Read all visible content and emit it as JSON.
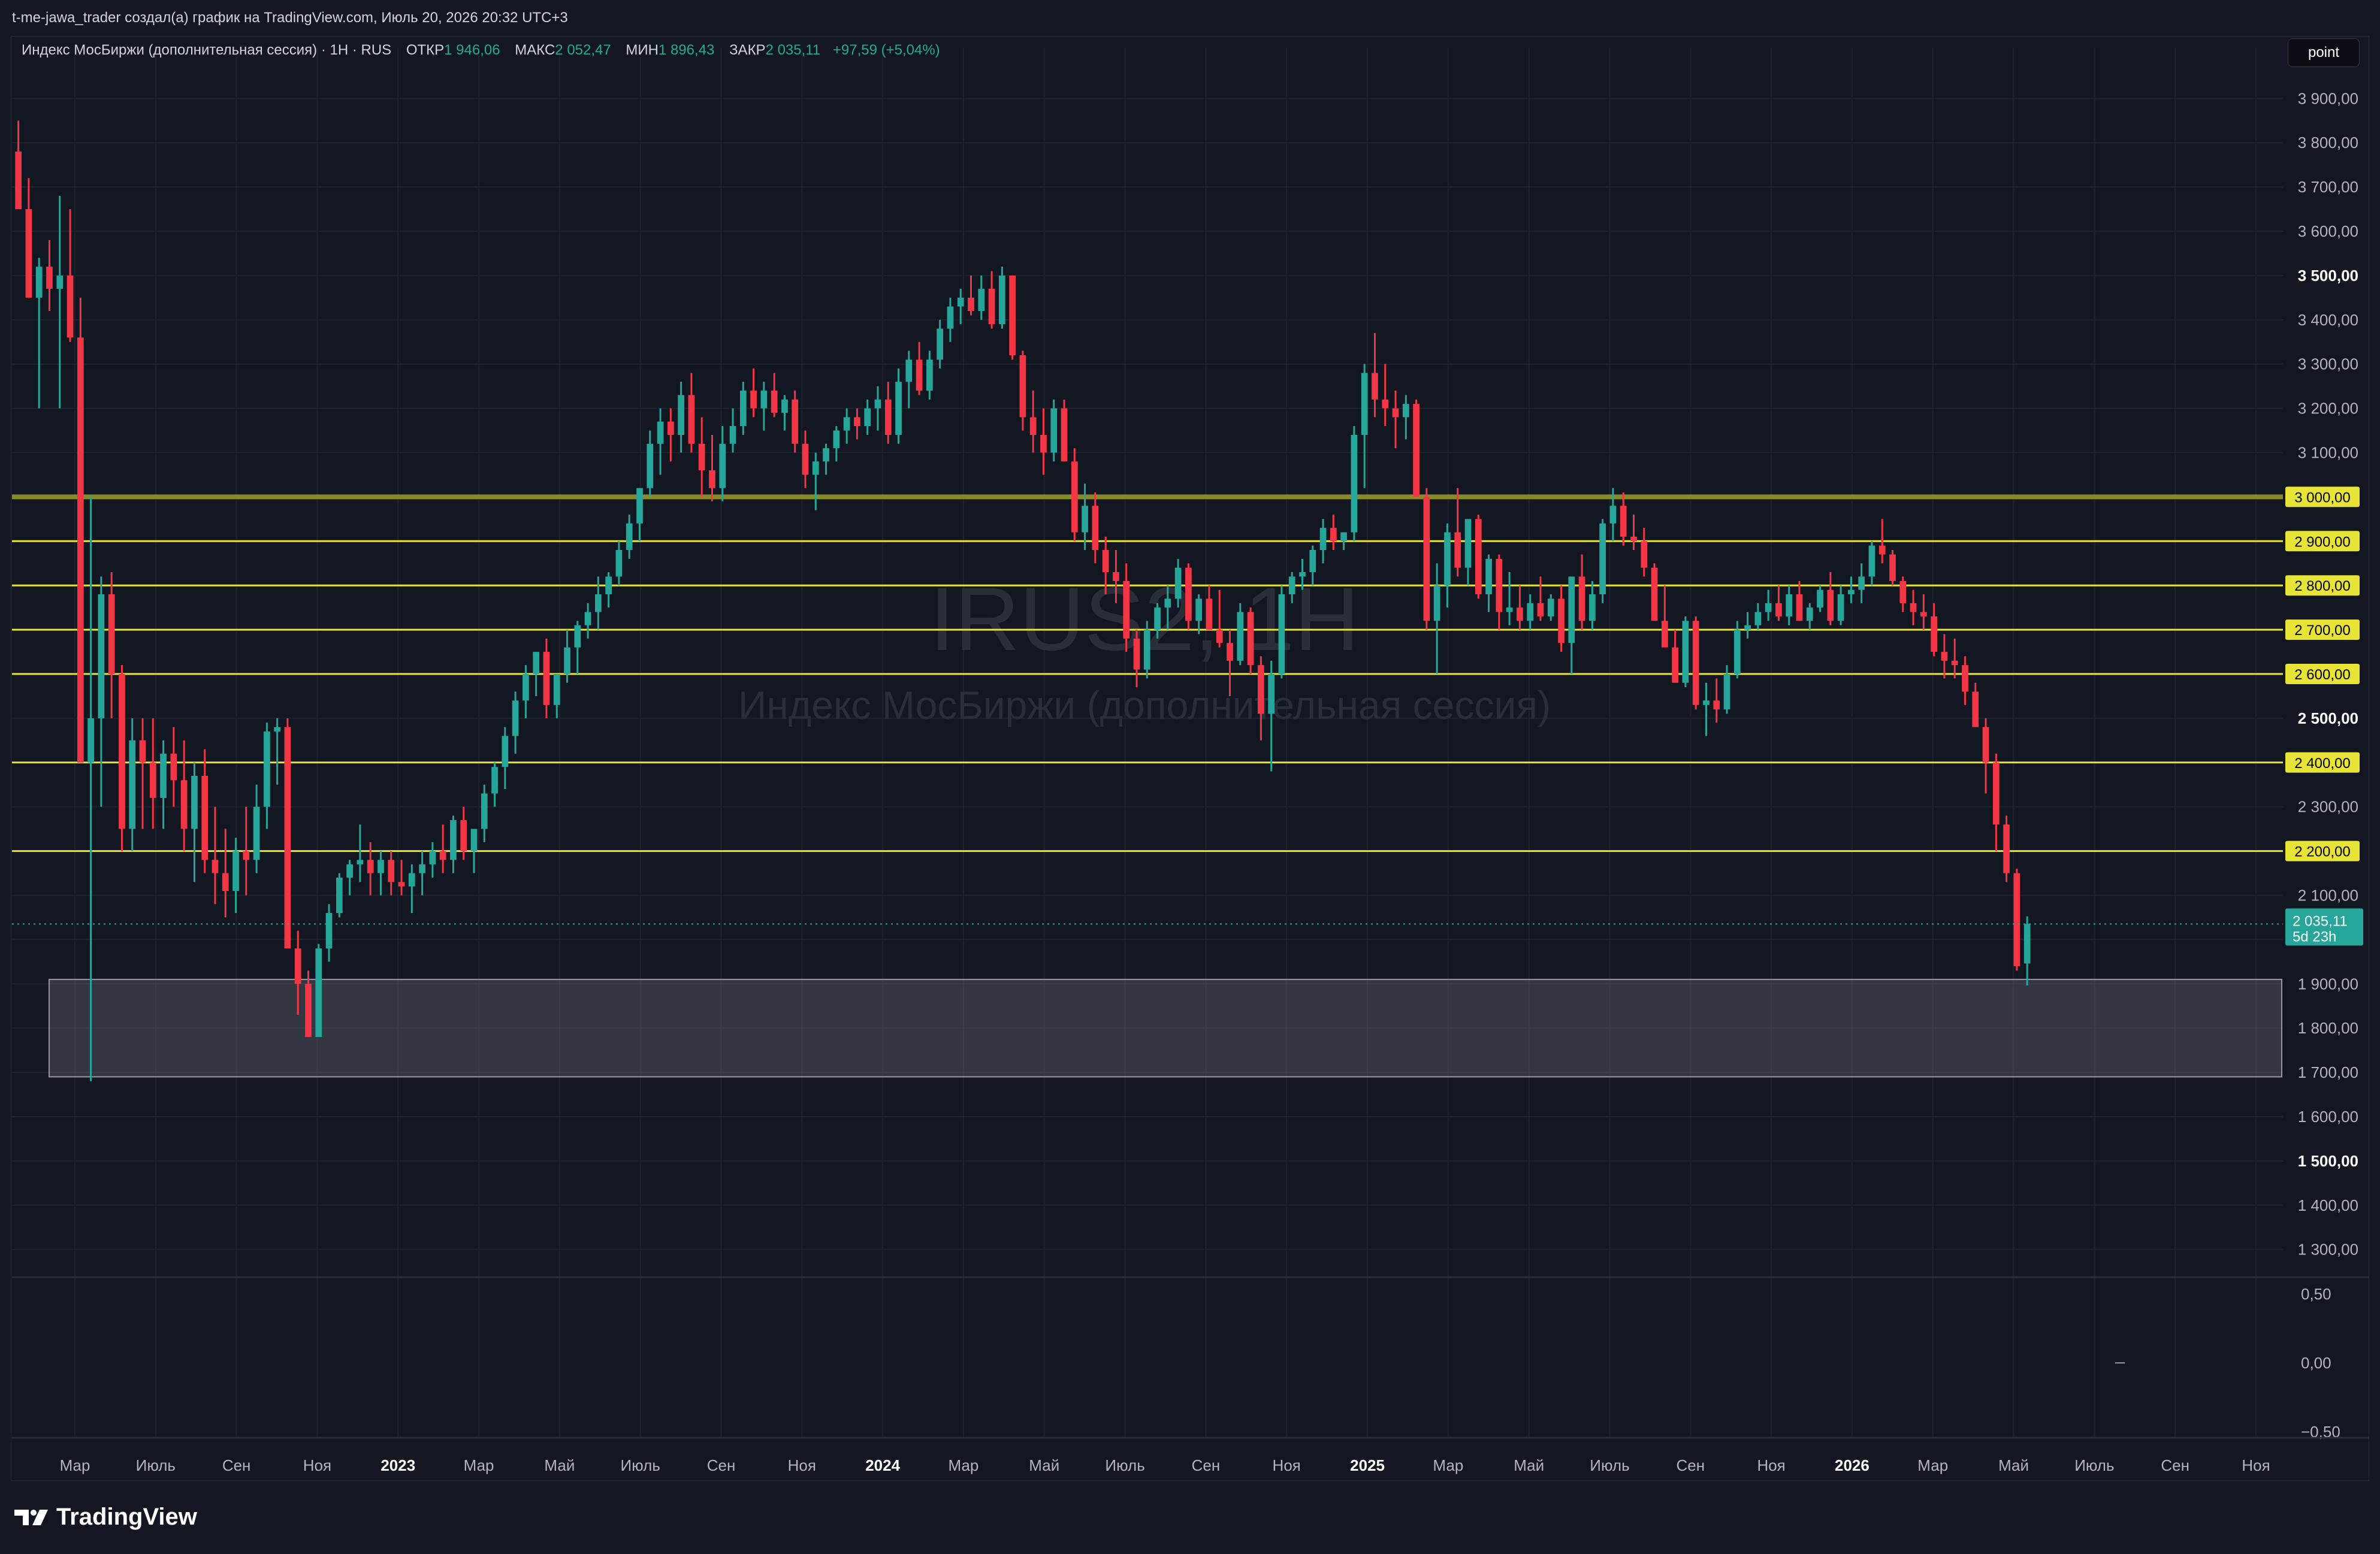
{
  "header": {
    "attribution": "t-me-jawa_trader создал(а) график на TradingView.com, Июль 20, 2026 20:32 UTC+3"
  },
  "legend": {
    "symbol": "Индекс МосБиржи (дополнительная сессия) · 1H · RUS",
    "open_label": "ОТКР",
    "open_value": "1 946,06",
    "high_label": "МАКС",
    "high_value": "2 052,47",
    "low_label": "МИН",
    "low_value": "1 896,43",
    "close_label": "ЗАКР",
    "close_value": "2 035,11",
    "change": "+97,59 (+5,04%)"
  },
  "toolbar": {
    "point_label": "point"
  },
  "watermark": {
    "ticker": "IRUS2, 1H",
    "name": "Индекс МосБиржи (дополнительная сессия)"
  },
  "price_badge": {
    "value": "2 035,11",
    "countdown": "5d 23h"
  },
  "colors": {
    "up": "#26a69a",
    "down": "#f23645",
    "level_line": "#e8e337",
    "level_major": "#8a8a2a",
    "zone": "#5d606b",
    "background": "#131722"
  },
  "branding": {
    "logo_text": "TradingView"
  },
  "chart_data": {
    "type": "candlestick",
    "y_axis_ticks": [
      "3 900,00",
      "3 800,00",
      "3 700,00",
      "3 600,00",
      "3 500,00",
      "3 400,00",
      "3 300,00",
      "3 200,00",
      "3 100,00",
      "3 000,00",
      "2 900,00",
      "2 800,00",
      "2 700,00",
      "2 600,00",
      "2 500,00",
      "2 400,00",
      "2 300,00",
      "2 200,00",
      "2 100,00",
      "2 000,00",
      "1 900,00",
      "1 800,00",
      "1 700,00",
      "1 600,00",
      "1 500,00",
      "1 400,00",
      "1 300,00"
    ],
    "ylim": [
      1240,
      3960
    ],
    "x_axis_ticks": [
      "Мар",
      "Июль",
      "Сен",
      "Ноя",
      "2023",
      "Мар",
      "Май",
      "Июль",
      "Сен",
      "Ноя",
      "2024",
      "Мар",
      "Май",
      "Июль",
      "Сен",
      "Ноя",
      "2025",
      "Мар",
      "Май",
      "Июль",
      "Сен",
      "Ноя",
      "2026",
      "Мар",
      "Май",
      "Июль",
      "Сен",
      "Ноя"
    ],
    "horizontal_levels": [
      {
        "price": 3000,
        "label": "3 000,00",
        "major": true
      },
      {
        "price": 2900,
        "label": "2 900,00"
      },
      {
        "price": 2800,
        "label": "2 800,00"
      },
      {
        "price": 2700,
        "label": "2 700,00"
      },
      {
        "price": 2600,
        "label": "2 600,00"
      },
      {
        "price": 2400,
        "label": "2 400,00"
      },
      {
        "price": 2200,
        "label": "2 200,00"
      }
    ],
    "zone": {
      "from": 1690,
      "to": 1910
    },
    "last_price": 2035.11,
    "indicator_ticks": [
      "0,50",
      "0,00",
      "−0,50"
    ],
    "candles": [
      [
        3780,
        3850,
        3650,
        3650
      ],
      [
        3650,
        3720,
        3450,
        3450
      ],
      [
        3450,
        3540,
        3200,
        3520
      ],
      [
        3520,
        3580,
        3420,
        3470
      ],
      [
        3470,
        3680,
        3200,
        3500
      ],
      [
        3500,
        3650,
        3350,
        3360
      ],
      [
        3360,
        3450,
        3000,
        2400
      ],
      [
        2400,
        3000,
        1680,
        2500
      ],
      [
        2500,
        2820,
        2300,
        2780
      ],
      [
        2780,
        2830,
        2500,
        2600
      ],
      [
        2600,
        2620,
        2200,
        2250
      ],
      [
        2250,
        2500,
        2200,
        2450
      ],
      [
        2450,
        2500,
        2250,
        2400
      ],
      [
        2400,
        2500,
        2250,
        2320
      ],
      [
        2320,
        2450,
        2250,
        2420
      ],
      [
        2420,
        2480,
        2300,
        2360
      ],
      [
        2360,
        2450,
        2200,
        2250
      ],
      [
        2250,
        2400,
        2130,
        2370
      ],
      [
        2370,
        2430,
        2150,
        2180
      ],
      [
        2180,
        2300,
        2080,
        2150
      ],
      [
        2150,
        2250,
        2050,
        2110
      ],
      [
        2110,
        2230,
        2060,
        2200
      ],
      [
        2200,
        2300,
        2100,
        2180
      ],
      [
        2180,
        2350,
        2150,
        2300
      ],
      [
        2300,
        2490,
        2250,
        2470
      ],
      [
        2470,
        2500,
        2350,
        2480
      ],
      [
        2480,
        2500,
        1980,
        1980
      ],
      [
        1980,
        2020,
        1830,
        1900
      ],
      [
        1900,
        1930,
        1780,
        1780
      ],
      [
        1780,
        1990,
        1780,
        1980
      ],
      [
        1980,
        2080,
        1950,
        2060
      ],
      [
        2060,
        2150,
        2050,
        2140
      ],
      [
        2140,
        2180,
        2100,
        2170
      ],
      [
        2170,
        2260,
        2130,
        2180
      ],
      [
        2180,
        2220,
        2100,
        2150
      ],
      [
        2150,
        2200,
        2100,
        2180
      ],
      [
        2180,
        2200,
        2100,
        2130
      ],
      [
        2130,
        2180,
        2100,
        2120
      ],
      [
        2120,
        2170,
        2060,
        2150
      ],
      [
        2150,
        2200,
        2100,
        2170
      ],
      [
        2170,
        2220,
        2140,
        2200
      ],
      [
        2200,
        2260,
        2150,
        2180
      ],
      [
        2180,
        2280,
        2150,
        2270
      ],
      [
        2270,
        2300,
        2180,
        2200
      ],
      [
        2200,
        2250,
        2150,
        2250
      ],
      [
        2250,
        2350,
        2220,
        2330
      ],
      [
        2330,
        2400,
        2300,
        2390
      ],
      [
        2390,
        2480,
        2340,
        2460
      ],
      [
        2460,
        2560,
        2420,
        2540
      ],
      [
        2540,
        2620,
        2500,
        2600
      ],
      [
        2600,
        2650,
        2550,
        2650
      ],
      [
        2650,
        2680,
        2500,
        2530
      ],
      [
        2530,
        2600,
        2500,
        2600
      ],
      [
        2600,
        2700,
        2580,
        2660
      ],
      [
        2660,
        2720,
        2600,
        2710
      ],
      [
        2710,
        2760,
        2680,
        2740
      ],
      [
        2740,
        2820,
        2700,
        2780
      ],
      [
        2780,
        2830,
        2750,
        2820
      ],
      [
        2820,
        2900,
        2800,
        2880
      ],
      [
        2880,
        2960,
        2860,
        2940
      ],
      [
        2940,
        3020,
        2900,
        3020
      ],
      [
        3020,
        3150,
        3000,
        3120
      ],
      [
        3120,
        3200,
        3050,
        3170
      ],
      [
        3170,
        3200,
        3080,
        3140
      ],
      [
        3140,
        3260,
        3100,
        3230
      ],
      [
        3230,
        3280,
        3100,
        3120
      ],
      [
        3120,
        3180,
        3000,
        3060
      ],
      [
        3060,
        3140,
        2990,
        3020
      ],
      [
        3020,
        3160,
        2990,
        3120
      ],
      [
        3120,
        3200,
        3100,
        3160
      ],
      [
        3160,
        3260,
        3140,
        3240
      ],
      [
        3240,
        3290,
        3180,
        3200
      ],
      [
        3200,
        3260,
        3150,
        3240
      ],
      [
        3240,
        3280,
        3180,
        3190
      ],
      [
        3190,
        3230,
        3150,
        3220
      ],
      [
        3220,
        3240,
        3100,
        3120
      ],
      [
        3120,
        3150,
        3020,
        3050
      ],
      [
        3050,
        3100,
        2970,
        3080
      ],
      [
        3080,
        3120,
        3050,
        3110
      ],
      [
        3110,
        3160,
        3080,
        3150
      ],
      [
        3150,
        3200,
        3120,
        3180
      ],
      [
        3180,
        3200,
        3130,
        3160
      ],
      [
        3160,
        3220,
        3140,
        3200
      ],
      [
        3200,
        3250,
        3150,
        3220
      ],
      [
        3220,
        3260,
        3120,
        3140
      ],
      [
        3140,
        3290,
        3120,
        3260
      ],
      [
        3260,
        3330,
        3200,
        3310
      ],
      [
        3310,
        3350,
        3230,
        3240
      ],
      [
        3240,
        3330,
        3220,
        3310
      ],
      [
        3310,
        3400,
        3290,
        3380
      ],
      [
        3380,
        3450,
        3350,
        3430
      ],
      [
        3430,
        3470,
        3390,
        3450
      ],
      [
        3450,
        3500,
        3410,
        3420
      ],
      [
        3420,
        3500,
        3400,
        3470
      ],
      [
        3470,
        3510,
        3380,
        3390
      ],
      [
        3390,
        3520,
        3380,
        3500
      ],
      [
        3500,
        3500,
        3310,
        3320
      ],
      [
        3320,
        3330,
        3150,
        3180
      ],
      [
        3180,
        3240,
        3100,
        3140
      ],
      [
        3140,
        3200,
        3050,
        3100
      ],
      [
        3100,
        3220,
        3080,
        3200
      ],
      [
        3200,
        3220,
        3080,
        3080
      ],
      [
        3080,
        3110,
        2900,
        2920
      ],
      [
        2920,
        3030,
        2880,
        2980
      ],
      [
        2980,
        3010,
        2850,
        2880
      ],
      [
        2880,
        2910,
        2780,
        2830
      ],
      [
        2830,
        2880,
        2760,
        2810
      ],
      [
        2810,
        2850,
        2650,
        2680
      ],
      [
        2680,
        2700,
        2570,
        2610
      ],
      [
        2610,
        2720,
        2590,
        2700
      ],
      [
        2700,
        2760,
        2680,
        2750
      ],
      [
        2750,
        2800,
        2700,
        2770
      ],
      [
        2770,
        2860,
        2750,
        2840
      ],
      [
        2840,
        2850,
        2700,
        2720
      ],
      [
        2720,
        2780,
        2690,
        2770
      ],
      [
        2770,
        2800,
        2700,
        2700
      ],
      [
        2700,
        2790,
        2660,
        2670
      ],
      [
        2670,
        2700,
        2550,
        2630
      ],
      [
        2630,
        2760,
        2620,
        2740
      ],
      [
        2740,
        2750,
        2600,
        2620
      ],
      [
        2620,
        2640,
        2450,
        2510
      ],
      [
        2510,
        2630,
        2380,
        2600
      ],
      [
        2600,
        2800,
        2590,
        2780
      ],
      [
        2780,
        2830,
        2760,
        2820
      ],
      [
        2820,
        2860,
        2790,
        2830
      ],
      [
        2830,
        2890,
        2800,
        2880
      ],
      [
        2880,
        2950,
        2850,
        2930
      ],
      [
        2930,
        2960,
        2880,
        2900
      ],
      [
        2900,
        2920,
        2880,
        2920
      ],
      [
        2920,
        3160,
        2900,
        3140
      ],
      [
        3140,
        3300,
        3020,
        3280
      ],
      [
        3280,
        3370,
        3180,
        3220
      ],
      [
        3220,
        3300,
        3160,
        3200
      ],
      [
        3200,
        3240,
        3110,
        3180
      ],
      [
        3180,
        3230,
        3130,
        3210
      ],
      [
        3210,
        3220,
        3010,
        3000
      ],
      [
        3000,
        3020,
        2700,
        2720
      ],
      [
        2720,
        2850,
        2600,
        2800
      ],
      [
        2800,
        2940,
        2750,
        2920
      ],
      [
        2920,
        3020,
        2820,
        2840
      ],
      [
        2840,
        2950,
        2800,
        2950
      ],
      [
        2950,
        2960,
        2770,
        2780
      ],
      [
        2780,
        2870,
        2740,
        2860
      ],
      [
        2860,
        2870,
        2700,
        2740
      ],
      [
        2740,
        2830,
        2710,
        2750
      ],
      [
        2750,
        2800,
        2700,
        2720
      ],
      [
        2720,
        2780,
        2700,
        2760
      ],
      [
        2760,
        2820,
        2720,
        2730
      ],
      [
        2730,
        2780,
        2720,
        2770
      ],
      [
        2770,
        2800,
        2650,
        2670
      ],
      [
        2670,
        2780,
        2600,
        2820
      ],
      [
        2820,
        2870,
        2700,
        2720
      ],
      [
        2720,
        2810,
        2700,
        2780
      ],
      [
        2780,
        2950,
        2760,
        2940
      ],
      [
        2940,
        3020,
        2900,
        2980
      ],
      [
        2980,
        3010,
        2890,
        2910
      ],
      [
        2910,
        2960,
        2880,
        2900
      ],
      [
        2900,
        2930,
        2820,
        2840
      ],
      [
        2840,
        2850,
        2750,
        2720
      ],
      [
        2720,
        2800,
        2700,
        2660
      ],
      [
        2660,
        2700,
        2590,
        2580
      ],
      [
        2580,
        2730,
        2570,
        2720
      ],
      [
        2720,
        2730,
        2520,
        2530
      ],
      [
        2530,
        2580,
        2460,
        2540
      ],
      [
        2540,
        2590,
        2490,
        2520
      ],
      [
        2520,
        2620,
        2510,
        2600
      ],
      [
        2600,
        2720,
        2590,
        2700
      ],
      [
        2700,
        2740,
        2680,
        2710
      ],
      [
        2710,
        2760,
        2700,
        2740
      ],
      [
        2740,
        2790,
        2720,
        2760
      ],
      [
        2760,
        2800,
        2720,
        2730
      ],
      [
        2730,
        2800,
        2710,
        2780
      ],
      [
        2780,
        2810,
        2720,
        2720
      ],
      [
        2720,
        2760,
        2700,
        2750
      ],
      [
        2750,
        2800,
        2740,
        2790
      ],
      [
        2790,
        2830,
        2710,
        2720
      ],
      [
        2720,
        2800,
        2710,
        2780
      ],
      [
        2780,
        2820,
        2760,
        2790
      ],
      [
        2790,
        2850,
        2760,
        2820
      ],
      [
        2820,
        2900,
        2800,
        2890
      ],
      [
        2890,
        2950,
        2850,
        2870
      ],
      [
        2870,
        2880,
        2800,
        2810
      ],
      [
        2810,
        2820,
        2740,
        2760
      ],
      [
        2760,
        2790,
        2710,
        2740
      ],
      [
        2740,
        2780,
        2700,
        2730
      ],
      [
        2730,
        2760,
        2640,
        2650
      ],
      [
        2650,
        2690,
        2590,
        2630
      ],
      [
        2630,
        2680,
        2590,
        2620
      ],
      [
        2620,
        2640,
        2530,
        2560
      ],
      [
        2560,
        2580,
        2490,
        2480
      ],
      [
        2480,
        2500,
        2330,
        2400
      ],
      [
        2400,
        2420,
        2200,
        2260
      ],
      [
        2260,
        2280,
        2130,
        2150
      ],
      [
        2150,
        2160,
        1930,
        1940
      ],
      [
        1946.06,
        2052.47,
        1896.43,
        2035.11
      ]
    ]
  }
}
